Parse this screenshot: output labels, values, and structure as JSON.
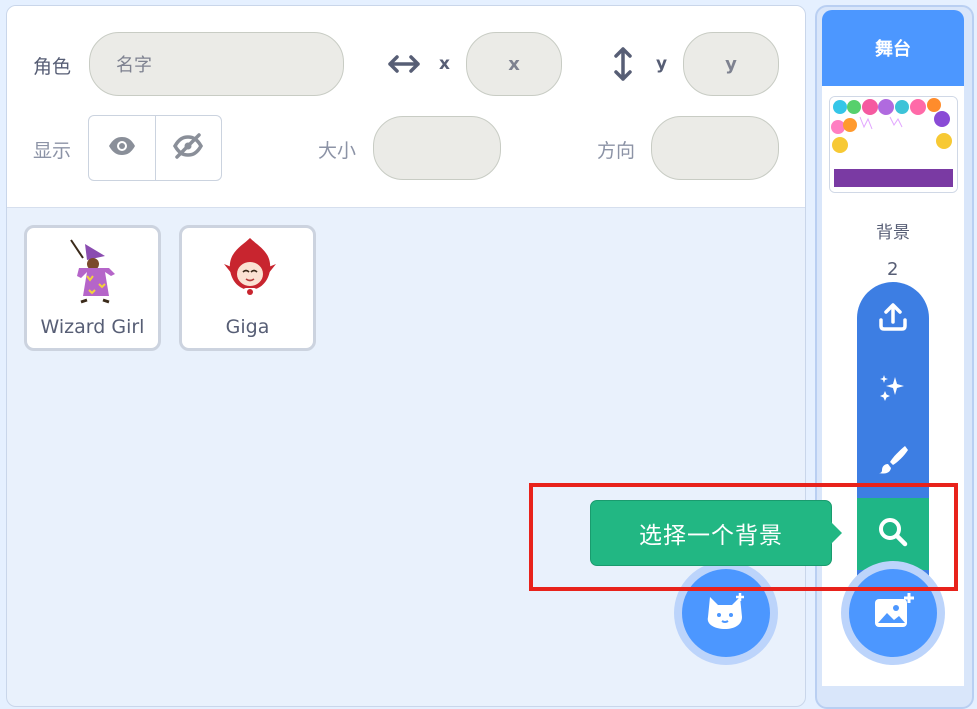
{
  "sprite_info": {
    "sprite_label": "角色",
    "name_placeholder": "名字",
    "x_label": "x",
    "x_value": "x",
    "y_label": "y",
    "y_value": "y",
    "show_label": "显示",
    "size_label": "大小",
    "direction_label": "方向"
  },
  "sprites": [
    {
      "name": "Wizard Girl"
    },
    {
      "name": "Giga"
    }
  ],
  "stage": {
    "header": "舞台",
    "backdrops_label": "背景",
    "backdrop_count": "2"
  },
  "backdrop_menu": {
    "tooltip": "选择一个背景",
    "items": [
      "upload-icon",
      "surprise-icon",
      "paint-icon",
      "search-icon"
    ]
  },
  "colors": {
    "accent": "#4c97ff",
    "menu_blue": "#3d7ee3",
    "tooltip_green": "#22b783",
    "highlight_red": "#e8221b"
  }
}
